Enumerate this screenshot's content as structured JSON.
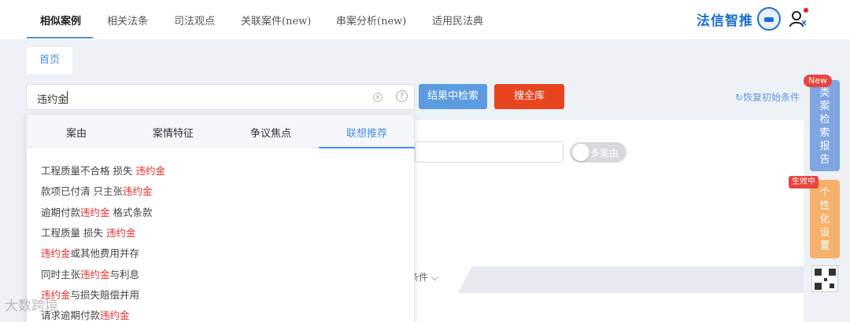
{
  "nav": {
    "items": [
      "相似案例",
      "相关法条",
      "司法观点",
      "关联案件(new)",
      "串案分析(new)",
      "适用民法典"
    ],
    "logo_text": "法信智推"
  },
  "tabs": {
    "home": "首页"
  },
  "search": {
    "value": "违约金",
    "clear_glyph": "×",
    "help_glyph": "?",
    "search_within_label": "结果中检索",
    "search_all_label": "搜全库",
    "reset_label": "恢复初始条件"
  },
  "dropdown": {
    "tabs": [
      "案由",
      "案情特征",
      "争议焦点",
      "联想推荐"
    ],
    "active_tab": "联想推荐",
    "suggestions": [
      {
        "pre": "工程质量不合格 损失 ",
        "hl": "违约金",
        "post": ""
      },
      {
        "pre": "款项已付清 只主张",
        "hl": "违约金",
        "post": ""
      },
      {
        "pre": "逾期付款",
        "hl": "违约金",
        "post": " 格式条款"
      },
      {
        "pre": "工程质量 损失 ",
        "hl": "违约金",
        "post": ""
      },
      {
        "pre": "",
        "hl": "违约金",
        "post": "或其他费用并存"
      },
      {
        "pre": "同时主张",
        "hl": "违约金",
        "post": "与利息"
      },
      {
        "pre": "",
        "hl": "违约金",
        "post": "与损失赔偿并用"
      },
      {
        "pre": "请求逾期付款",
        "hl": "违约金",
        "post": ""
      }
    ]
  },
  "panel": {
    "multi_cause_label": "多案由",
    "conditions_label": "条件"
  },
  "side": {
    "report_label": "类案检索报告",
    "report_badge": "New",
    "settings_label": "个性化设置",
    "settings_badge": "生效中"
  },
  "watermark": "大数跨境"
}
